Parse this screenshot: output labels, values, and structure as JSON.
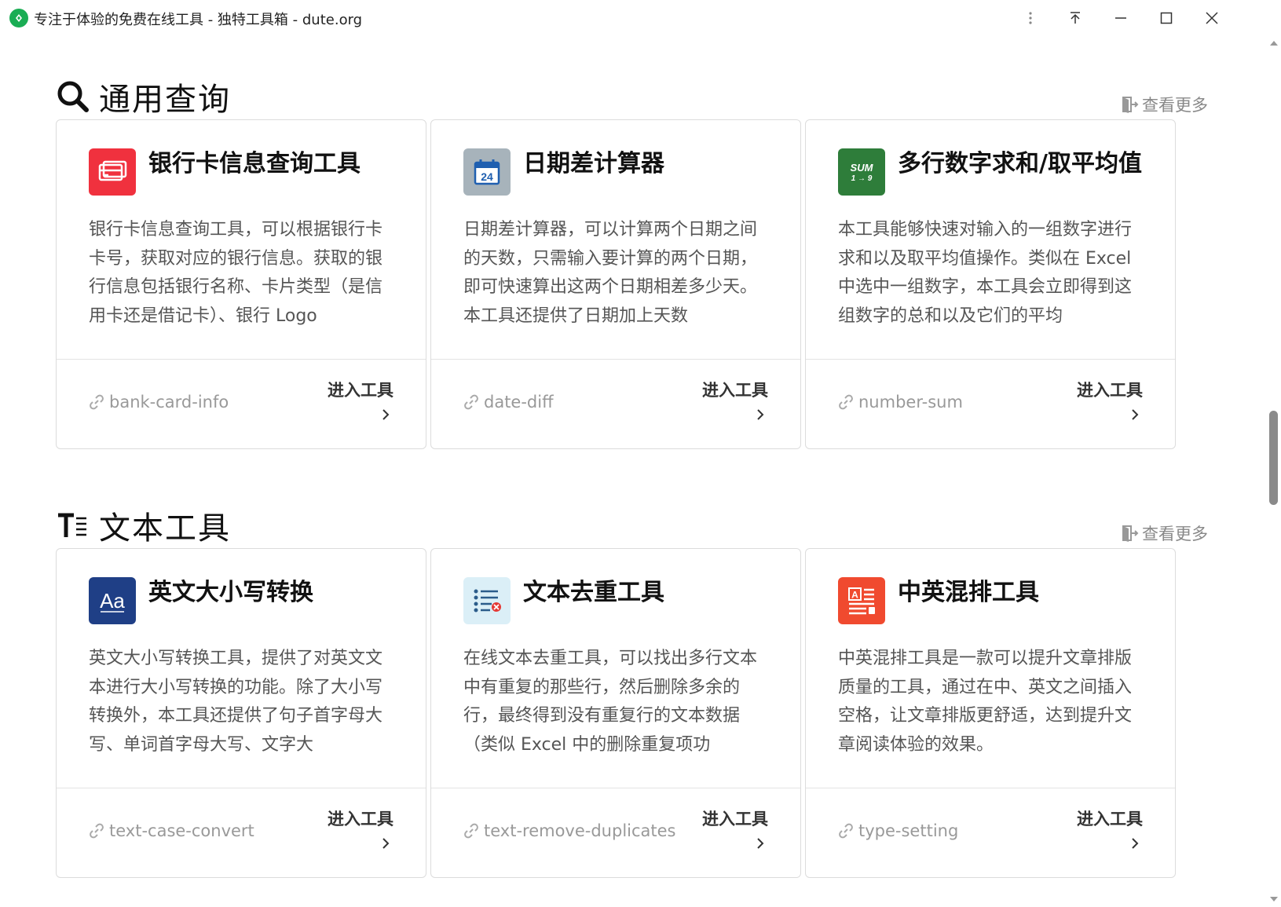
{
  "window": {
    "title": "专注于体验的免费在线工具 - 独特工具箱 - dute.org"
  },
  "sections": [
    {
      "title": "通用查询",
      "more_label": "查看更多",
      "cards": [
        {
          "title": "银行卡信息查询工具",
          "description": "银行卡信息查询工具，可以根据银行卡卡号，获取对应的银行信息。获取的银行信息包括银行名称、卡片类型（是信用卡还是借记卡）、银行 Logo",
          "slug": "bank-card-info",
          "enter_label": "进入工具",
          "icon": "bank-card-icon",
          "icon_color": "#f0313e"
        },
        {
          "title": "日期差计算器",
          "description": "日期差计算器，可以计算两个日期之间的天数，只需输入要计算的两个日期，即可快速算出这两个日期相差多少天。本工具还提供了日期加上天数",
          "slug": "date-diff",
          "enter_label": "进入工具",
          "icon": "calendar-icon",
          "icon_color": "#a7b3bb"
        },
        {
          "title": "多行数字求和/取平均值",
          "description": "本工具能够快速对输入的一组数字进行求和以及取平均值操作。类似在 Excel 中选中一组数字，本工具会立即得到这组数字的总和以及它们的平均",
          "slug": "number-sum",
          "enter_label": "进入工具",
          "icon": "sum-icon",
          "icon_color": "#2e7d3a"
        }
      ]
    },
    {
      "title": "文本工具",
      "more_label": "查看更多",
      "cards": [
        {
          "title": "英文大小写转换",
          "description": "英文大小写转换工具，提供了对英文文本进行大小写转换的功能。除了大小写转换外，本工具还提供了句子首字母大写、单词首字母大写、文字大",
          "slug": "text-case-convert",
          "enter_label": "进入工具",
          "icon": "letter-case-icon",
          "icon_color": "#1f3f86"
        },
        {
          "title": "文本去重工具",
          "description": "在线文本去重工具，可以找出多行文本中有重复的那些行，然后删除多余的行，最终得到没有重复行的文本数据（类似 Excel 中的删除重复项功",
          "slug": "text-remove-duplicates",
          "enter_label": "进入工具",
          "icon": "list-remove-icon",
          "icon_color": "#dbeff7"
        },
        {
          "title": "中英混排工具",
          "description": "中英混排工具是一款可以提升文章排版质量的工具，通过在中、英文之间插入空格，让文章排版更舒适，达到提升文章阅读体验的效果。",
          "slug": "type-setting",
          "enter_label": "进入工具",
          "icon": "typesetting-icon",
          "icon_color": "#f04a2f"
        }
      ]
    }
  ]
}
